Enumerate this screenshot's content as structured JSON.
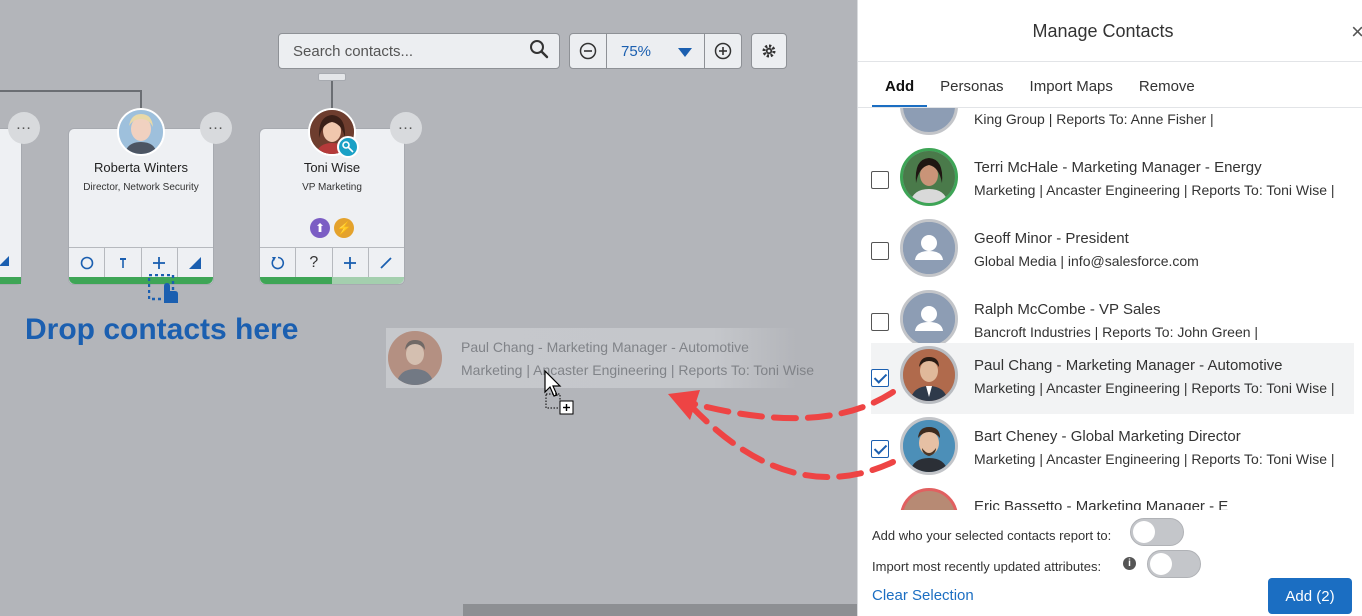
{
  "toolbar": {
    "search_placeholder": "Search contacts...",
    "zoom_value": "75%"
  },
  "cards": [
    {
      "name": "Roberta Winters",
      "title": "Director, Network Security",
      "progress": 1.0
    },
    {
      "name": "Toni Wise",
      "title": "VP Marketing",
      "progress": 0.5
    }
  ],
  "drop_hint": "Drop contacts here",
  "drag_ghost": {
    "line1": "Paul Chang  - Marketing Manager - Automotive",
    "line2": "Marketing | Ancaster Engineering | Reports To: Toni Wise"
  },
  "panel": {
    "title": "Manage Contacts",
    "close_label": "×",
    "tabs": [
      {
        "label": "Add",
        "active": true
      },
      {
        "label": "Personas",
        "active": false
      },
      {
        "label": "Import Maps",
        "active": false
      },
      {
        "label": "Remove",
        "active": false
      }
    ],
    "partial_top": "King Group | Reports To: Anne Fisher |",
    "contacts": [
      {
        "name_line": "Terri McHale  - Marketing Manager - Energy",
        "detail_line": "Marketing | Ancaster Engineering | Reports To: Toni Wise |",
        "checked": false
      },
      {
        "name_line": "Geoff Minor  - President",
        "detail_line": "Global Media | info@salesforce.com",
        "checked": false
      },
      {
        "name_line": "Ralph McCombe  - VP Sales",
        "detail_line": "Bancroft Industries | Reports To: John Green |",
        "checked": false
      },
      {
        "name_line": "Paul Chang  - Marketing Manager - Automotive",
        "detail_line": "Marketing | Ancaster Engineering | Reports To: Toni Wise |",
        "checked": true
      },
      {
        "name_line": "Bart Cheney  - Global Marketing Director",
        "detail_line": "Marketing | Ancaster Engineering | Reports To: Toni Wise |",
        "checked": true
      }
    ],
    "partial_bottom": "Eric Bassetto - Marketing Manager - E",
    "options": {
      "report_to_label": "Add who your selected contacts report to:",
      "import_attrs_label": "Import most recently updated attributes:",
      "info_glyph": "i"
    },
    "clear_label": "Clear Selection",
    "add_label": "Add (2)"
  },
  "colors": {
    "accent": "#1b6ec2",
    "drop_text": "#1b5fb0",
    "progress": "#3ea556",
    "annotation_arrow": "#ee4444"
  }
}
